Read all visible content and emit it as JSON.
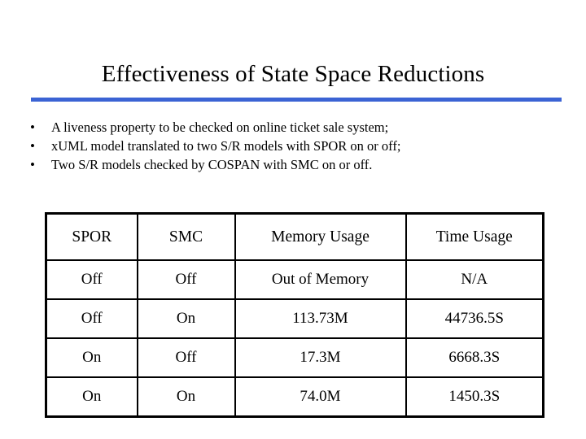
{
  "slide": {
    "title": "Effectiveness of State Space Reductions",
    "accent_color": "#3b63d4",
    "background_color": "#ffffff",
    "text_color": "#000000"
  },
  "bullets": {
    "marker": "•",
    "items": [
      "A liveness property to be checked on online ticket sale system;",
      "xUML model translated to two S/R models with SPOR on or off;",
      "Two S/R models checked by COSPAN with SMC on or off."
    ]
  },
  "table": {
    "headers": [
      "SPOR",
      "SMC",
      "Memory Usage",
      "Time Usage"
    ],
    "rows": [
      [
        "Off",
        "Off",
        "Out of Memory",
        "N/A"
      ],
      [
        "Off",
        "On",
        "113.73M",
        "44736.5S"
      ],
      [
        "On",
        "Off",
        "17.3M",
        "6668.3S"
      ],
      [
        "On",
        "On",
        "74.0M",
        "1450.3S"
      ]
    ]
  }
}
